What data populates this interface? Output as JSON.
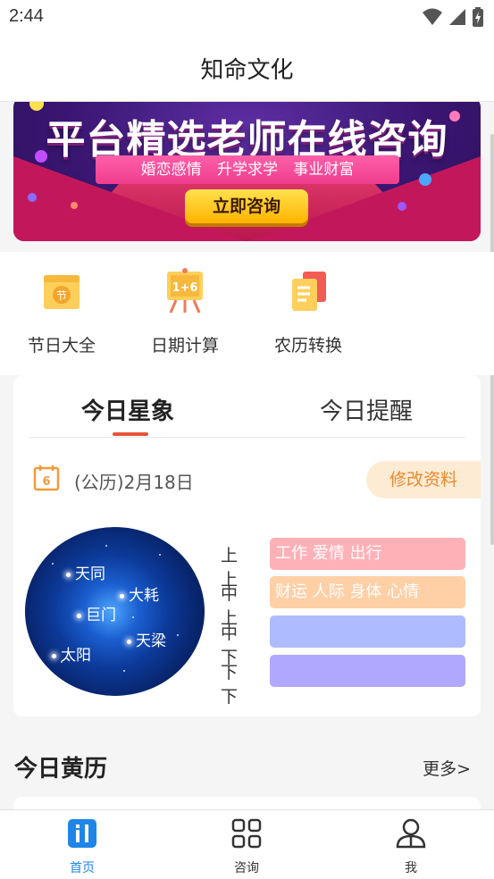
{
  "status_bar": {
    "time": "2:44"
  },
  "header": {
    "title": "知命文化"
  },
  "banner": {
    "title": "平台精选老师在线咨询",
    "tags": "婚恋感情 升学求学 事业财富",
    "button_label": "立即咨询"
  },
  "tools": [
    {
      "label": "节日大全",
      "icon": "festival-icon"
    },
    {
      "label": "日期计算",
      "icon": "date-calc-icon"
    },
    {
      "label": "农历转换",
      "icon": "lunar-convert-icon"
    }
  ],
  "astro": {
    "tabs": [
      "今日星象",
      "今日提醒"
    ],
    "active_tab": 0,
    "calendar_day": "6",
    "date_text": "(公历)2月18日",
    "edit_label": "修改资料",
    "stars": [
      "天同",
      "大耗",
      "巨门",
      "天梁",
      "太阳"
    ],
    "fortunes": [
      {
        "level": "上上",
        "items": "工作 爱情 出行",
        "color": "#ffb1b8"
      },
      {
        "level": "中上",
        "items": "财运 人际 身体 心情",
        "color": "#ffcfa6"
      },
      {
        "level": "中下",
        "items": "",
        "color": "#aebcff"
      },
      {
        "level": "下下",
        "items": "",
        "color": "#b0a8ff"
      }
    ]
  },
  "almanac": {
    "title": "今日黄历",
    "more_label": "更多>"
  },
  "bottom_nav": [
    {
      "label": "首页",
      "icon": "home-icon",
      "active": true
    },
    {
      "label": "咨询",
      "icon": "grid-icon",
      "active": false
    },
    {
      "label": "我",
      "icon": "person-icon",
      "active": false
    }
  ],
  "colors": {
    "accent": "#1f86e8",
    "tab_underline": "#e8533a",
    "edit_bg": "#fdebd3",
    "edit_text": "#e88a2e"
  }
}
